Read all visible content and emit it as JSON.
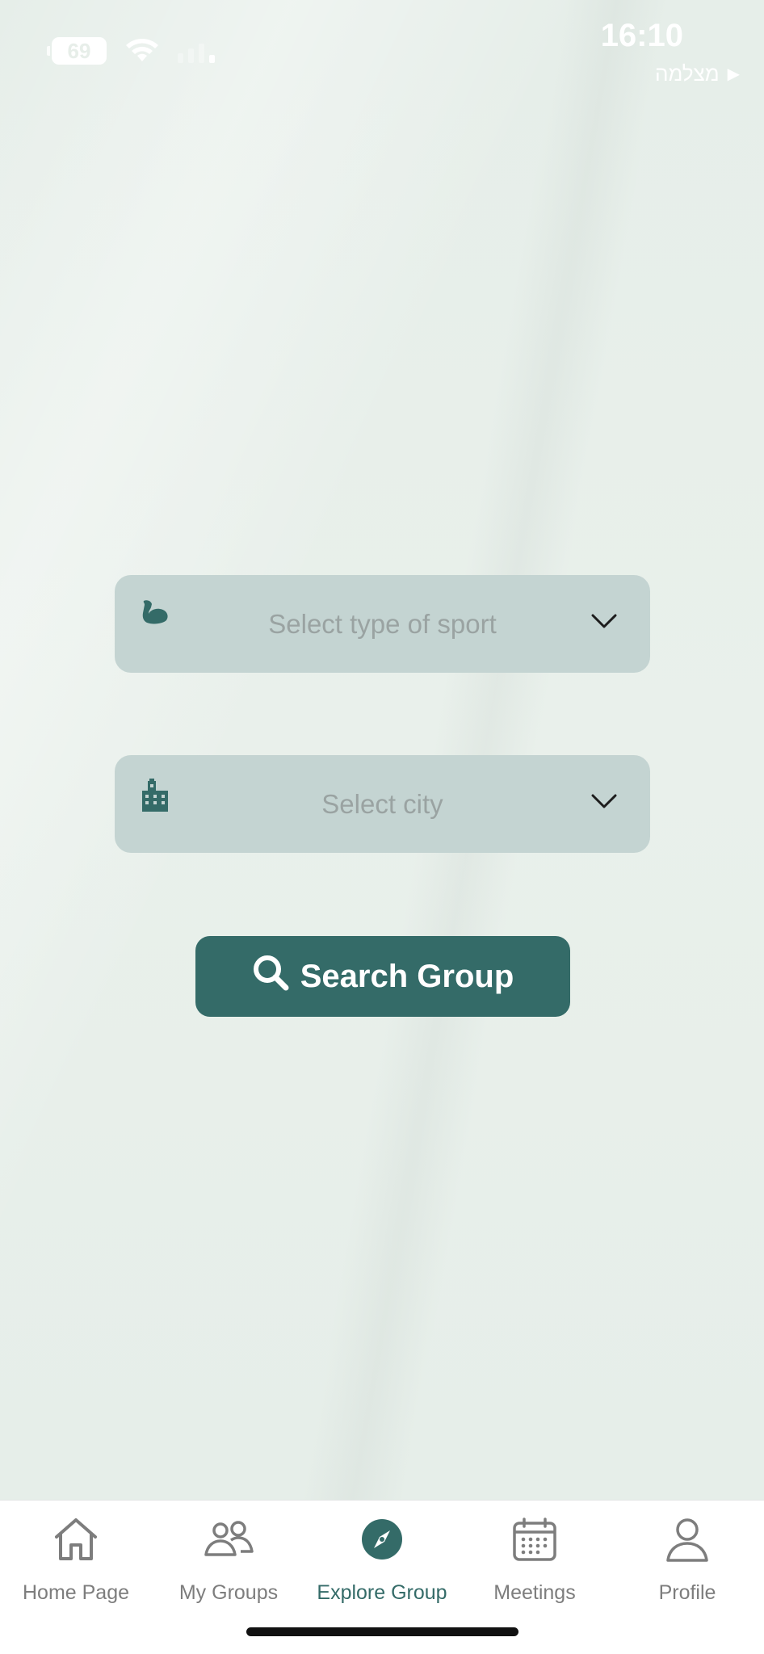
{
  "status_bar": {
    "battery": "69",
    "time": "16:10",
    "back_label": "מצלמה"
  },
  "form": {
    "sport_placeholder": "Select type of sport",
    "city_placeholder": "Select city",
    "search_button": "Search Group"
  },
  "tabs": [
    {
      "label": "Home Page",
      "icon": "home-icon",
      "active": false
    },
    {
      "label": "My Groups",
      "icon": "groups-icon",
      "active": false
    },
    {
      "label": "Explore Group",
      "icon": "compass-icon",
      "active": true
    },
    {
      "label": "Meetings",
      "icon": "calendar-icon",
      "active": false
    },
    {
      "label": "Profile",
      "icon": "profile-icon",
      "active": false
    }
  ],
  "colors": {
    "accent": "#346b68",
    "dropdown_bg": "#c4d4d2",
    "background": "#e8efea",
    "inactive_tab": "#7d7d7d"
  }
}
